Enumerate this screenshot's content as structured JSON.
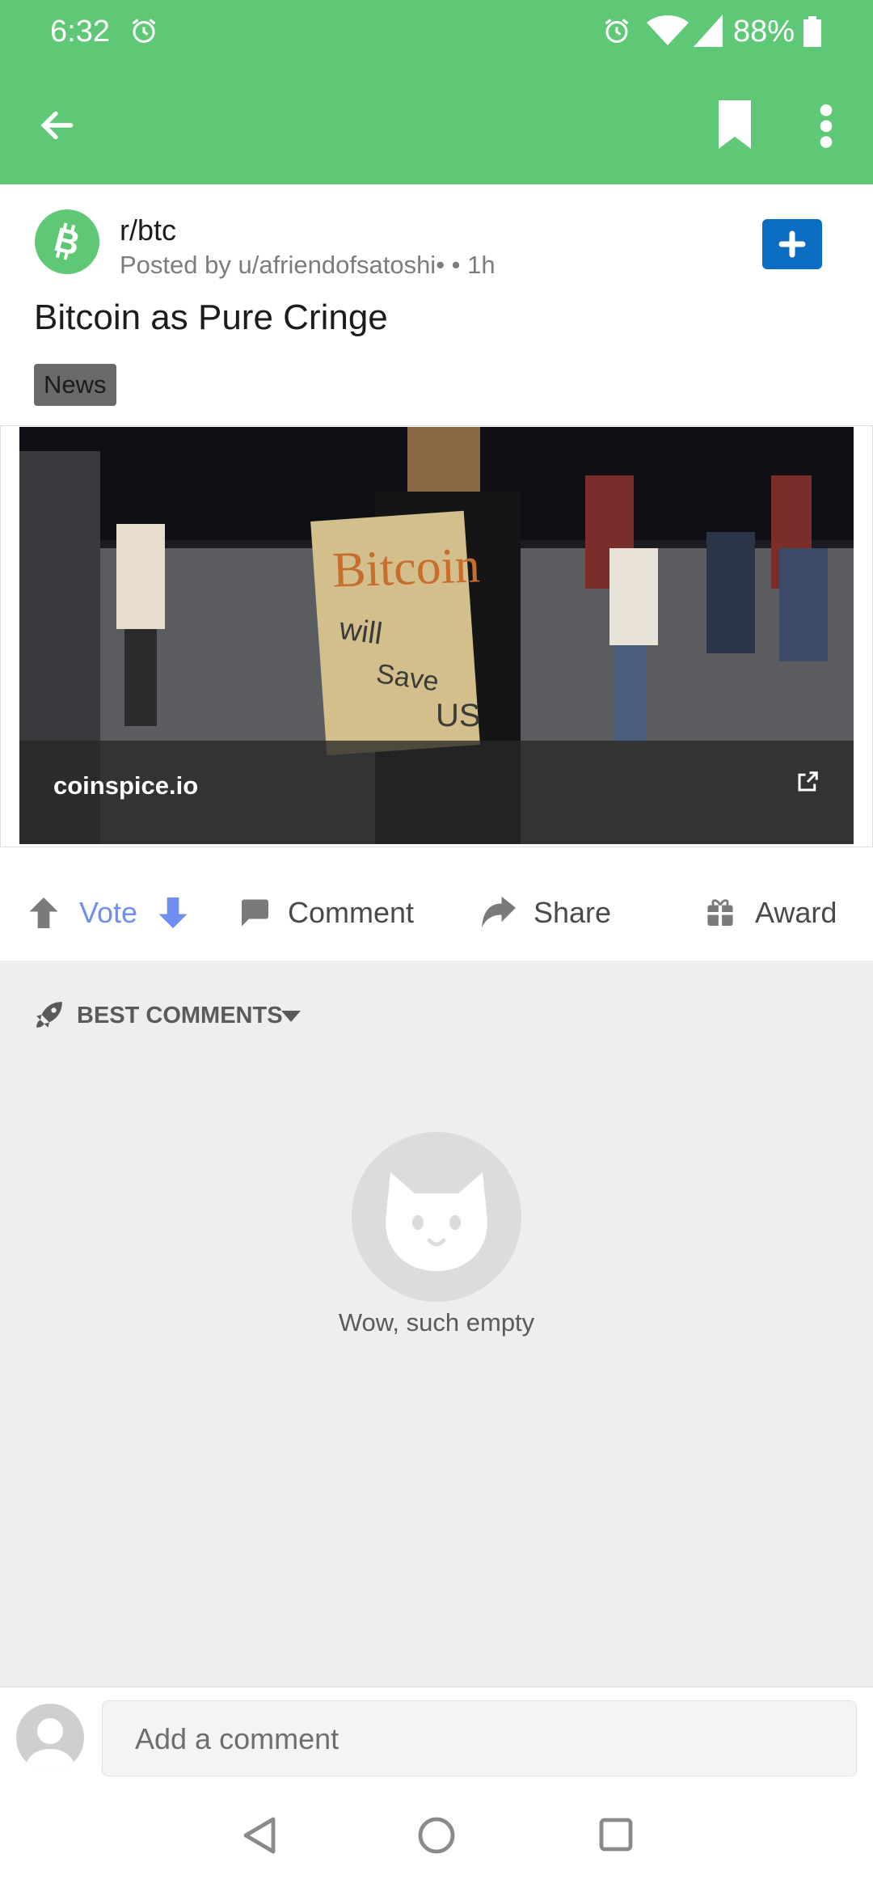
{
  "status_bar": {
    "time": "6:32",
    "battery": "88%"
  },
  "app_bar": {
    "back_icon": "arrow-left-icon",
    "bookmark_icon": "bookmark-icon",
    "more_icon": "more-vert-icon"
  },
  "post": {
    "subreddit": "r/btc",
    "posted_by": "Posted by u/afriendofsatoshi•",
    "age": " • 1h",
    "title": "Bitcoin as Pure Cringe",
    "flair": "News",
    "link_domain": "coinspice.io",
    "sign_lines": [
      "Bitcoin",
      "will",
      "Save",
      "US"
    ]
  },
  "actions": {
    "vote": "Vote",
    "comment": "Comment",
    "share": "Share",
    "award": "Award"
  },
  "comments": {
    "sort_label": "BEST COMMENTS",
    "empty_text": "Wow, such empty"
  },
  "comment_bar": {
    "placeholder": "Add a comment"
  },
  "colors": {
    "brand_green": "#5fc876",
    "join_blue": "#0a6dc2",
    "vote_blue": "#6e8ff0"
  }
}
